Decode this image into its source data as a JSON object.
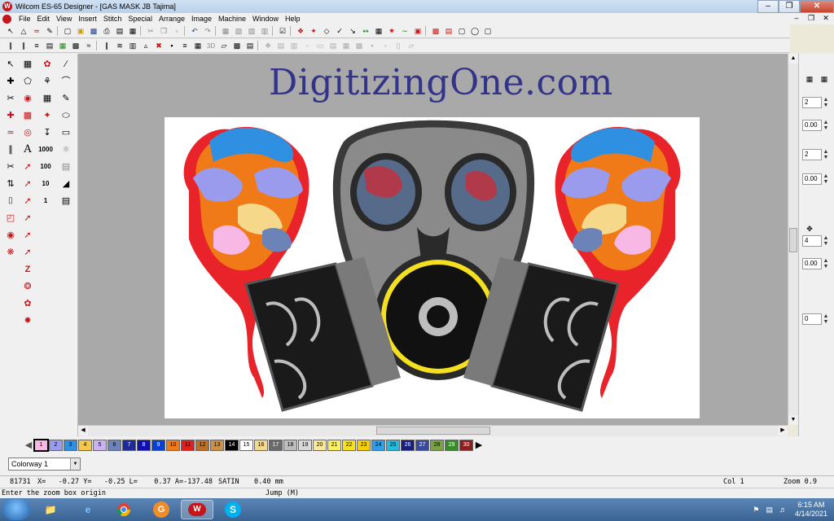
{
  "window": {
    "title": "Wilcom ES-65 Designer - [GAS MASK JB        Tajima]"
  },
  "menu": {
    "items": [
      "File",
      "Edit",
      "View",
      "Insert",
      "Stitch",
      "Special",
      "Arrange",
      "Image",
      "Machine",
      "Window",
      "Help"
    ]
  },
  "workspace": {
    "watermark": "DigitizingOne.com"
  },
  "right_panel": {
    "values": [
      "2",
      "0.00",
      "2",
      "0.00",
      "4",
      "0.00",
      "0"
    ]
  },
  "palette": {
    "chips": [
      {
        "num": "1",
        "color": "#f7b8e6"
      },
      {
        "num": "2",
        "color": "#9b9bee"
      },
      {
        "num": "3",
        "color": "#2f8fe0"
      },
      {
        "num": "4",
        "color": "#f5c84a"
      },
      {
        "num": "5",
        "color": "#c9b2f0"
      },
      {
        "num": "6",
        "color": "#6b83b6"
      },
      {
        "num": "7",
        "color": "#1c2a9a"
      },
      {
        "num": "8",
        "color": "#1010b0"
      },
      {
        "num": "9",
        "color": "#0a3fd0"
      },
      {
        "num": "10",
        "color": "#f07a18"
      },
      {
        "num": "11",
        "color": "#e02020"
      },
      {
        "num": "12",
        "color": "#b8702a"
      },
      {
        "num": "13",
        "color": "#c8904a"
      },
      {
        "num": "14",
        "color": "#000000"
      },
      {
        "num": "15",
        "color": "#ffffff"
      },
      {
        "num": "16",
        "color": "#f5d88a"
      },
      {
        "num": "17",
        "color": "#6a6a6a"
      },
      {
        "num": "18",
        "color": "#bdbdbd"
      },
      {
        "num": "19",
        "color": "#d8d8d8"
      },
      {
        "num": "20",
        "color": "#f8e89a"
      },
      {
        "num": "21",
        "color": "#f8f060"
      },
      {
        "num": "22",
        "color": "#f5e020"
      },
      {
        "num": "23",
        "color": "#f5d000"
      },
      {
        "num": "24",
        "color": "#2fa0e8"
      },
      {
        "num": "25",
        "color": "#28b8d8"
      },
      {
        "num": "26",
        "color": "#18207a"
      },
      {
        "num": "27",
        "color": "#3a4a9a"
      },
      {
        "num": "28",
        "color": "#7aa04a"
      },
      {
        "num": "29",
        "color": "#3a8a2a"
      },
      {
        "num": "30",
        "color": "#8a2020"
      }
    ]
  },
  "colorway": {
    "value": "Colorway 1"
  },
  "status": {
    "stitches": "81731",
    "coords": "X=   -0.27 Y=   -0.25 L=    0.37 A=-137.48",
    "stitch_type": "SATIN",
    "length": "0.40 mm",
    "column": "Col 1",
    "zoom": "Zoom 0.9",
    "prompt": "Enter the zoom box origin",
    "mode": "Jump (M)"
  },
  "taskbar": {
    "apps": [
      "explorer-icon",
      "ie-icon",
      "chrome-icon",
      "pdf-icon",
      "wilcom-icon",
      "skype-icon"
    ],
    "time": "6:15 AM",
    "date": "4/14/2021"
  },
  "colors": {
    "accent": "#c4161c",
    "workspace_bg": "#a9a9a9",
    "watermark": "#33338a"
  }
}
